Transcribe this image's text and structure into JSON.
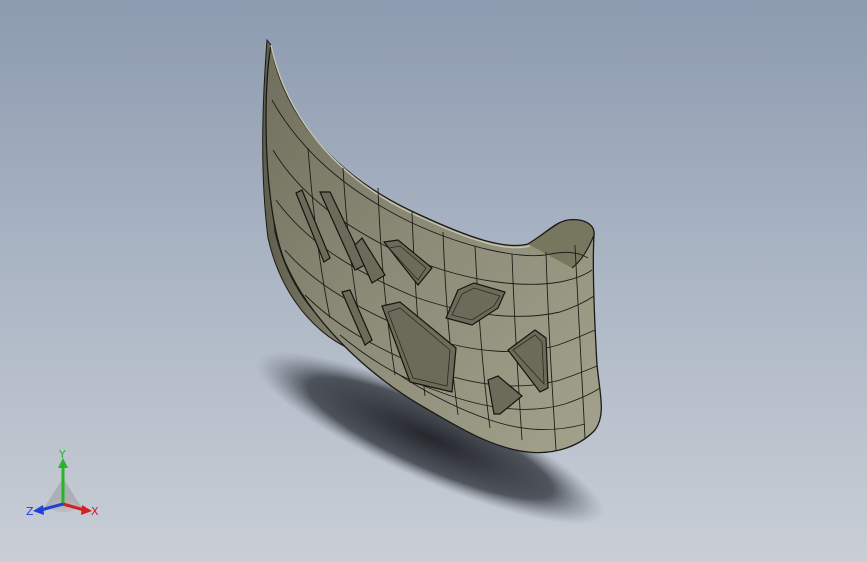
{
  "viewport": {
    "background_top": "#8d9bb0",
    "background_bottom": "#c9ced6",
    "part_color": "#83826f",
    "edge_color": "#1b1b16"
  },
  "triad": {
    "x_label": "X",
    "y_label": "Y",
    "z_label": "Z",
    "x_color": "#d42020",
    "y_color": "#28b428",
    "z_color": "#2040d8"
  }
}
